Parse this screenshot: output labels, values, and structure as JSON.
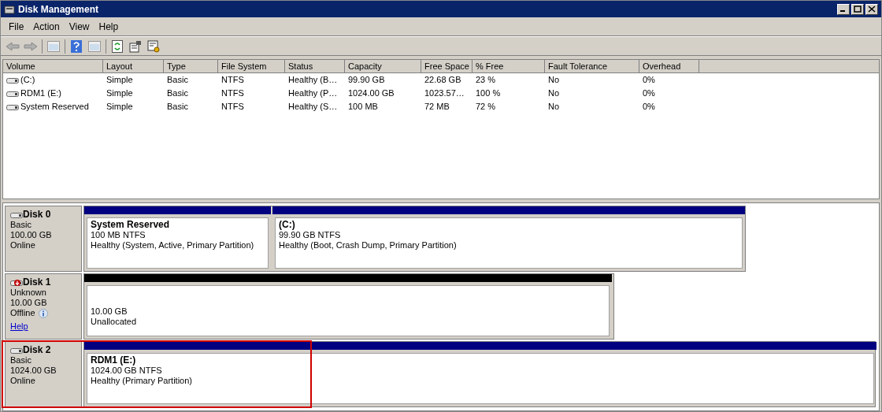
{
  "window": {
    "title": "Disk Management"
  },
  "menu": [
    "File",
    "Action",
    "View",
    "Help"
  ],
  "table": {
    "columns": [
      "Volume",
      "Layout",
      "Type",
      "File System",
      "Status",
      "Capacity",
      "Free Space",
      "% Free",
      "Fault Tolerance",
      "Overhead"
    ],
    "rows": [
      [
        "(C:)",
        "Simple",
        "Basic",
        "NTFS",
        "Healthy (B…",
        "99.90 GB",
        "22.68 GB",
        "23 %",
        "No",
        "0%"
      ],
      [
        "RDM1 (E:)",
        "Simple",
        "Basic",
        "NTFS",
        "Healthy (P…",
        "1024.00 GB",
        "1023.57…",
        "100 %",
        "No",
        "0%"
      ],
      [
        "System Reserved",
        "Simple",
        "Basic",
        "NTFS",
        "Healthy (S…",
        "100 MB",
        "72 MB",
        "72 %",
        "No",
        "0%"
      ]
    ]
  },
  "disks": [
    {
      "name": "Disk 0",
      "kind": "online",
      "type": "Basic",
      "size": "100.00 GB",
      "status": "Online",
      "highlighted": false,
      "partitions": [
        {
          "kind": "primary",
          "title": "System Reserved",
          "size": "100 MB NTFS",
          "status": "Healthy (System, Active, Primary Partition)"
        },
        {
          "kind": "primary",
          "title": "(C:)",
          "size": "99.90 GB NTFS",
          "status": "Healthy (Boot, Crash Dump, Primary Partition)"
        }
      ]
    },
    {
      "name": "Disk 1",
      "kind": "offline",
      "type": "Unknown",
      "size": "10.00 GB",
      "status": "Offline",
      "help": "Help",
      "highlighted": false,
      "partitions": [
        {
          "kind": "unallocated",
          "size": "10.00 GB",
          "status": "Unallocated"
        }
      ]
    },
    {
      "name": "Disk 2",
      "kind": "online",
      "type": "Basic",
      "size": "1024.00 GB",
      "status": "Online",
      "highlighted": true,
      "partitions": [
        {
          "kind": "primary",
          "title": "RDM1  (E:)",
          "size": "1024.00 GB NTFS",
          "status": "Healthy (Primary Partition)"
        }
      ]
    }
  ]
}
